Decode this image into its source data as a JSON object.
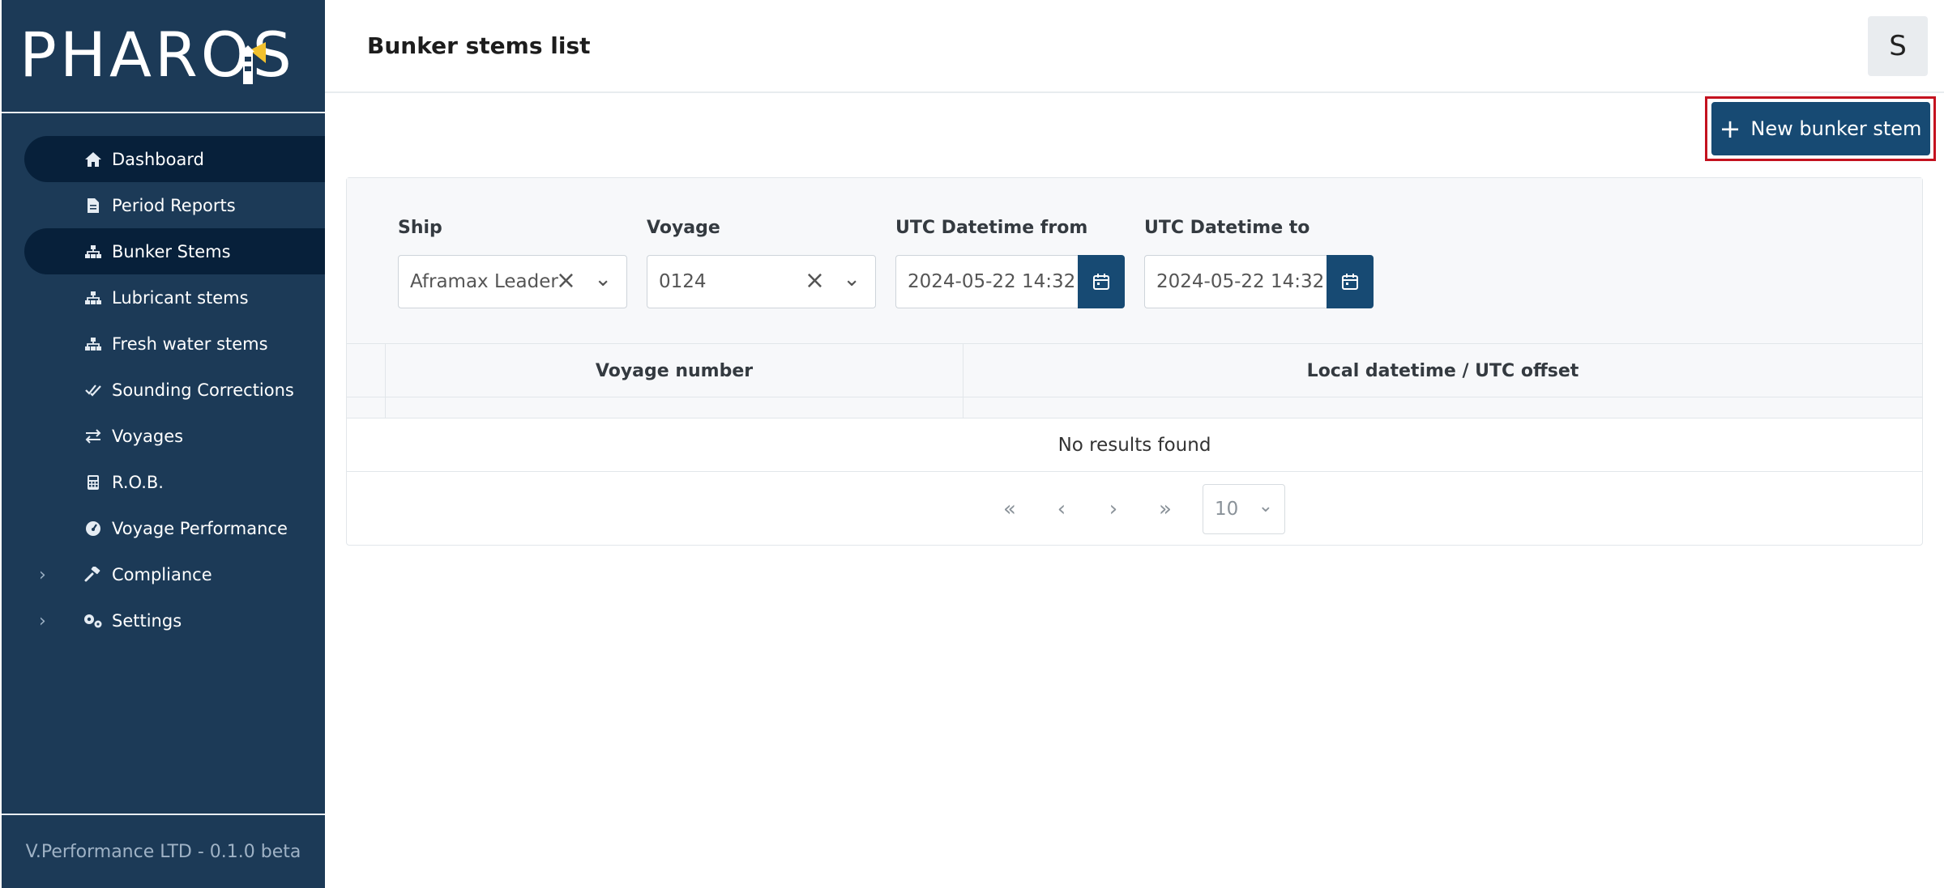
{
  "brand": {
    "name": "PHAROS"
  },
  "sidebar": {
    "items": [
      {
        "label": "Dashboard",
        "icon": "home-icon",
        "active": true
      },
      {
        "label": "Period Reports",
        "icon": "document-icon",
        "active": false
      },
      {
        "label": "Bunker Stems",
        "icon": "sitemap-icon",
        "active": true
      },
      {
        "label": "Lubricant stems",
        "icon": "sitemap-icon",
        "active": false
      },
      {
        "label": "Fresh water stems",
        "icon": "sitemap-icon",
        "active": false
      },
      {
        "label": "Sounding Corrections",
        "icon": "check-double-icon",
        "active": false
      },
      {
        "label": "Voyages",
        "icon": "exchange-icon",
        "active": false
      },
      {
        "label": "R.O.B.",
        "icon": "calculator-icon",
        "active": false
      },
      {
        "label": "Voyage Performance",
        "icon": "gauge-icon",
        "active": false
      },
      {
        "label": "Compliance",
        "icon": "gavel-icon",
        "active": false,
        "expandable": true
      },
      {
        "label": "Settings",
        "icon": "cogs-icon",
        "active": false,
        "expandable": true
      }
    ],
    "footer": "V.Performance LTD - 0.1.0 beta"
  },
  "header": {
    "title": "Bunker stems list",
    "avatar_initial": "S"
  },
  "toolbar": {
    "new_label": "New bunker stem"
  },
  "filters": {
    "ship": {
      "label": "Ship",
      "value": "Aframax Leader"
    },
    "voyage": {
      "label": "Voyage",
      "value": "0124"
    },
    "from": {
      "label": "UTC Datetime from",
      "value": "2024-05-22 14:32"
    },
    "to": {
      "label": "UTC Datetime to",
      "value": "2024-05-22 14:32"
    }
  },
  "table": {
    "columns": [
      "Voyage number",
      "Local datetime / UTC offset"
    ],
    "empty_text": "No results found"
  },
  "pagination": {
    "first": "«",
    "prev": "‹",
    "next": "›",
    "last": "»",
    "page_size": "10"
  },
  "colors": {
    "sidebar": "#1c3a57",
    "primary": "#174a73",
    "highlight": "#c4121f"
  }
}
